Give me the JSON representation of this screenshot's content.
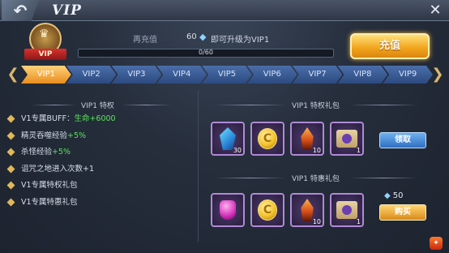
{
  "header": {
    "back_icon": "back-arrow-icon",
    "title": "VIP",
    "close_icon": "close-icon"
  },
  "emblem": {
    "label": "VIP"
  },
  "recharge": {
    "prefix": "再充值",
    "amount": "60",
    "suffix": "即可升级为VIP1",
    "progress_text": "0/60",
    "progress": 0.0
  },
  "topup_button": {
    "label": "充值"
  },
  "tabs": [
    "VIP1",
    "VIP2",
    "VIP3",
    "VIP4",
    "VIP5",
    "VIP6",
    "VIP7",
    "VIP8",
    "VIP9"
  ],
  "active_tab": "VIP1",
  "privileges": {
    "title": "VIP1 特权",
    "items": [
      {
        "text": "V1专属BUFF：",
        "highlight": "生命+6000"
      },
      {
        "text": "精灵吞噬经验",
        "highlight": "+5%"
      },
      {
        "text": "杀怪经验",
        "highlight": "+5%"
      },
      {
        "text": "诅咒之地进入次数+1",
        "highlight": ""
      },
      {
        "text": "V1专属特权礼包",
        "highlight": ""
      },
      {
        "text": "V1专属特惠礼包",
        "highlight": ""
      }
    ]
  },
  "privilege_pack": {
    "title": "VIP1 特权礼包",
    "items": [
      {
        "icon": "blue-crystal-icon",
        "count": "30"
      },
      {
        "icon": "gold-coin-icon",
        "count": ""
      },
      {
        "icon": "fire-crystal-icon",
        "count": "10"
      },
      {
        "icon": "magic-scroll-icon",
        "count": "1"
      }
    ],
    "button": "领取"
  },
  "discount_pack": {
    "title": "VIP1 特惠礼包",
    "items": [
      {
        "icon": "pink-gem-pouch-icon",
        "count": ""
      },
      {
        "icon": "gold-coin-icon",
        "count": ""
      },
      {
        "icon": "fire-crystal-icon",
        "count": "10"
      },
      {
        "icon": "magic-scroll-icon",
        "count": "1"
      }
    ],
    "price": "50",
    "button": "购买"
  },
  "colors": {
    "accent": "#f2a21a",
    "highlight_green": "#58e35a",
    "tab_blue": "#2d4a80"
  }
}
